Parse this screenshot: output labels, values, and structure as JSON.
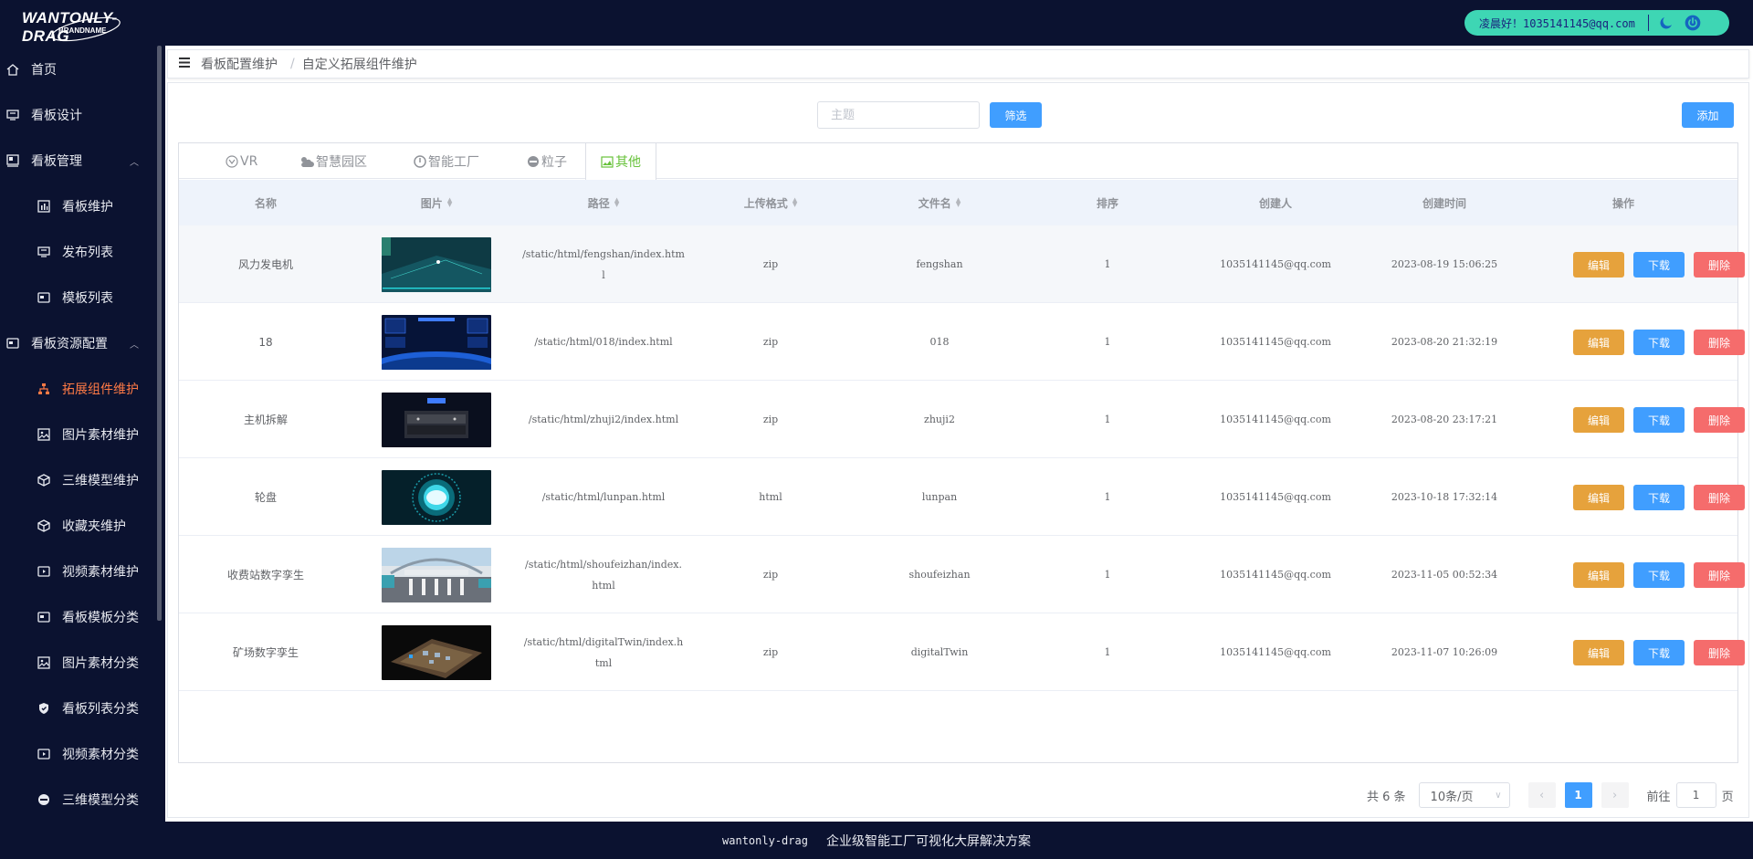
{
  "header": {
    "logo_text": "WANTONLY-DRAG",
    "logo_sub": "BRANDNAME",
    "greeting": "凌晨好！1035141145@qq.com"
  },
  "sidebar": {
    "items": [
      {
        "label": "首页",
        "icon": "home-icon",
        "level": "top"
      },
      {
        "label": "看板设计",
        "icon": "monitor-icon",
        "level": "top"
      },
      {
        "label": "看板管理",
        "icon": "dashboard-icon",
        "level": "top",
        "expanded": true
      },
      {
        "label": "看板维护",
        "icon": "bar-chart-icon",
        "level": "sub"
      },
      {
        "label": "发布列表",
        "icon": "monitor-icon",
        "level": "sub"
      },
      {
        "label": "模板列表",
        "icon": "card-icon",
        "level": "sub"
      },
      {
        "label": "看板资源配置",
        "icon": "card-icon",
        "level": "top",
        "expanded": true
      },
      {
        "label": "拓展组件维护",
        "icon": "sitemap-icon",
        "level": "sub",
        "active": true
      },
      {
        "label": "图片素材维护",
        "icon": "image-icon",
        "level": "sub"
      },
      {
        "label": "三维模型维护",
        "icon": "cube-icon",
        "level": "sub"
      },
      {
        "label": "收藏夹维护",
        "icon": "cube-icon",
        "level": "sub"
      },
      {
        "label": "视频素材维护",
        "icon": "video-icon",
        "level": "sub"
      },
      {
        "label": "看板模板分类",
        "icon": "card-icon",
        "level": "sub"
      },
      {
        "label": "图片素材分类",
        "icon": "image-icon",
        "level": "sub"
      },
      {
        "label": "看板列表分类",
        "icon": "shield-icon",
        "level": "sub"
      },
      {
        "label": "视频素材分类",
        "icon": "video-icon",
        "level": "sub"
      },
      {
        "label": "三维模型分类",
        "icon": "minus-circle-icon",
        "level": "sub"
      }
    ]
  },
  "breadcrumb": {
    "level1": "看板配置维护",
    "separator": "/",
    "level2": "自定义拓展组件维护"
  },
  "search": {
    "placeholder": "主题",
    "value": ""
  },
  "buttons": {
    "filter": "筛选",
    "add": "添加"
  },
  "tabs": [
    {
      "label": "VR",
      "icon": "vr-icon"
    },
    {
      "label": "智慧园区",
      "icon": "cloud-sun-icon"
    },
    {
      "label": "智能工厂",
      "icon": "power-icon"
    },
    {
      "label": "粒子",
      "icon": "minus-circle-icon"
    },
    {
      "label": "其他",
      "icon": "image-icon",
      "active": true
    }
  ],
  "table": {
    "columns": [
      "名称",
      "图片",
      "路径",
      "上传格式",
      "文件名",
      "排序",
      "创建人",
      "创建时间",
      "操作"
    ],
    "rows": [
      {
        "name": "风力发电机",
        "path": "/static/html/fengshan/index.html",
        "format": "zip",
        "file": "fengshan",
        "order": "1",
        "creator": "1035141145@qq.com",
        "time": "2023-08-19 15:06:25",
        "thumb": "wind-turbine-thumbnail"
      },
      {
        "name": "18",
        "path": "/static/html/018/index.html",
        "format": "zip",
        "file": "018",
        "order": "1",
        "creator": "1035141145@qq.com",
        "time": "2023-08-20 21:32:19",
        "thumb": "earth-dashboard-thumbnail"
      },
      {
        "name": "主机拆解",
        "path": "/static/html/zhuji2/index.html",
        "format": "zip",
        "file": "zhuji2",
        "order": "1",
        "creator": "1035141145@qq.com",
        "time": "2023-08-20 23:17:21",
        "thumb": "server-host-thumbnail"
      },
      {
        "name": "轮盘",
        "path": "/static/html/lunpan.html",
        "format": "html",
        "file": "lunpan",
        "order": "1",
        "creator": "1035141145@qq.com",
        "time": "2023-10-18 17:32:14",
        "thumb": "glowing-ring-thumbnail"
      },
      {
        "name": "收费站数字孪生",
        "path": "/static/html/shoufeizhan/index.html",
        "format": "zip",
        "file": "shoufeizhan",
        "order": "1",
        "creator": "1035141145@qq.com",
        "time": "2023-11-05 00:52:34",
        "thumb": "toll-station-thumbnail"
      },
      {
        "name": "矿场数字孪生",
        "path": "/static/html/digitalTwin/index.html",
        "format": "zip",
        "file": "digitalTwin",
        "order": "1",
        "creator": "1035141145@qq.com",
        "time": "2023-11-07 10:26:09",
        "thumb": "mine-site-thumbnail"
      }
    ],
    "actions": {
      "edit": "编辑",
      "download": "下载",
      "delete": "删除"
    }
  },
  "pagination": {
    "total": "共 6 条",
    "page_size": "10条/页",
    "current_page": "1",
    "goto_label": "前往",
    "goto_value": "1",
    "page_suffix": "页"
  },
  "footer": {
    "brand": "wantonly-drag",
    "slogan": "企业级智能工厂可视化大屏解决方案"
  },
  "colors": {
    "background": "#0b1230",
    "accent": "#409eff",
    "active_menu": "#ff7a45",
    "user_pill": "#3ed6b4",
    "edit": "#e6a23c",
    "delete": "#f56c6c",
    "active_tab": "#67c23a"
  }
}
